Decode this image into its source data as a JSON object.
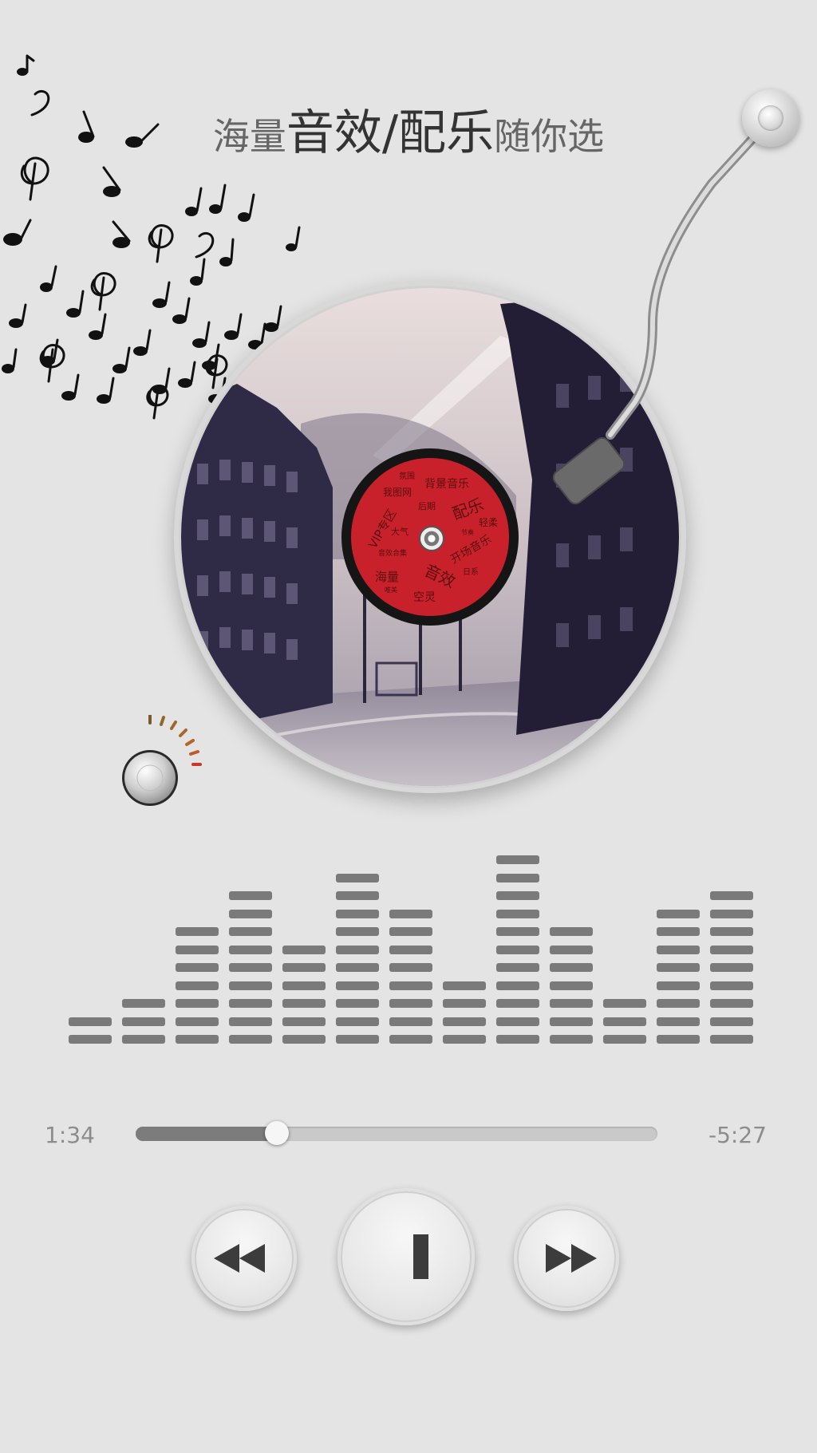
{
  "headline": {
    "part1": "海量",
    "part2": "音效/配乐",
    "part3": "随你选"
  },
  "record_label": {
    "texts": [
      "背景音乐",
      "我图网",
      "VIP专区",
      "配乐",
      "轻柔",
      "大气",
      "开场音乐",
      "海量",
      "音效",
      "空灵",
      "日系",
      "后期",
      "音效合集",
      "氛围",
      "唯美",
      "节奏"
    ]
  },
  "equalizer": {
    "levels": [
      2,
      3,
      7,
      9,
      6,
      10,
      8,
      4,
      11,
      7,
      3,
      8,
      9
    ]
  },
  "player": {
    "time_elapsed": "1:34",
    "time_remaining": "-5:27",
    "progress": 0.27
  },
  "controls": {
    "rewind_icon": "rewind-icon",
    "play_pause_icon": "pause-icon",
    "fast_forward_icon": "fast-forward-icon"
  },
  "colors": {
    "background": "#e4e4e4",
    "record_label": "#c9212b",
    "eq_bar": "#7a7a7a",
    "progress_fill": "#7c7c7c"
  }
}
